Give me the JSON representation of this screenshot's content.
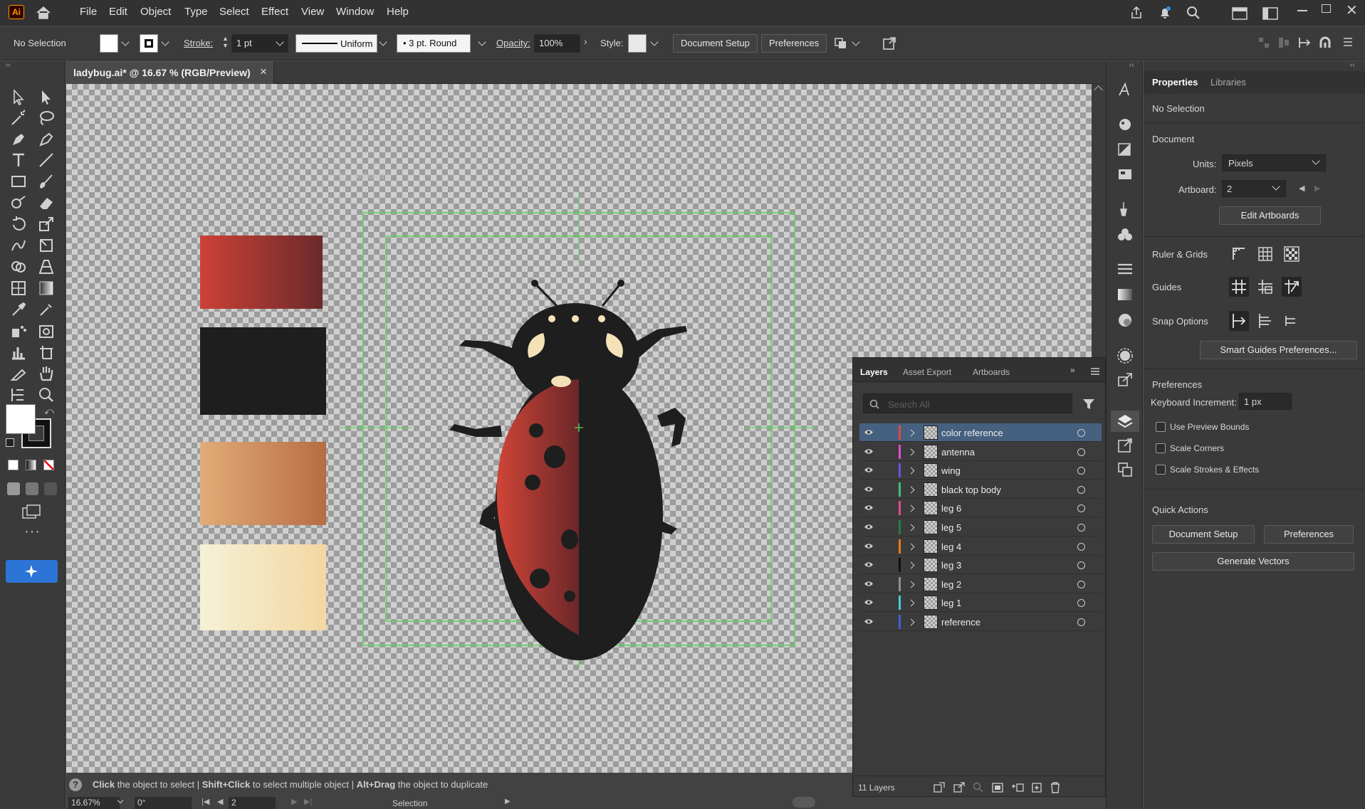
{
  "app": {
    "logo": "Ai"
  },
  "menu": [
    "File",
    "Edit",
    "Object",
    "Type",
    "Select",
    "Effect",
    "View",
    "Window",
    "Help"
  ],
  "control": {
    "selection": "No Selection",
    "stroke_label": "Stroke:",
    "stroke_weight": "1 pt",
    "stroke_profile": "Uniform",
    "brush": "3 pt. Round",
    "opacity_label": "Opacity:",
    "opacity": "100%",
    "style_label": "Style:",
    "document_setup": "Document Setup",
    "preferences": "Preferences"
  },
  "document_tab": {
    "title": "ladybug.ai* @ 16.67 % (RGB/Preview)",
    "close": "×"
  },
  "canvas": {
    "artboard_label": "01 - Artboard 1",
    "swatches": [
      "#c83f34",
      "#1e1e1e",
      "#d6905c",
      "#f4e8cc"
    ]
  },
  "status": {
    "hint_1": "Click",
    "hint_1b": " the object to select  |  ",
    "hint_2": "Shift+Click",
    "hint_2b": " to select multiple object  |  ",
    "hint_3": "Alt+Drag",
    "hint_3b": " the object to duplicate",
    "zoom": "16.67%",
    "rotation": "0°",
    "artboard_num": "2",
    "tool_name": "Selection"
  },
  "layers_panel": {
    "tabs": [
      "Layers",
      "Asset Export",
      "Artboards"
    ],
    "search_placeholder": "Search All",
    "count": "11 Layers",
    "layers": [
      {
        "name": "color reference",
        "color": "#e04848",
        "selected": true
      },
      {
        "name": "antenna",
        "color": "#e050d0",
        "selected": false
      },
      {
        "name": "wing",
        "color": "#7050e0",
        "selected": false
      },
      {
        "name": "black top body",
        "color": "#40c070",
        "selected": false
      },
      {
        "name": "leg 6",
        "color": "#e84890",
        "selected": false
      },
      {
        "name": "leg 5",
        "color": "#208040",
        "selected": false
      },
      {
        "name": "leg 4",
        "color": "#e87820",
        "selected": false
      },
      {
        "name": "leg 3",
        "color": "#101010",
        "selected": false
      },
      {
        "name": "leg 2",
        "color": "#909090",
        "selected": false
      },
      {
        "name": "leg 1",
        "color": "#40d0e0",
        "selected": false
      },
      {
        "name": "reference",
        "color": "#4060d8",
        "selected": false
      }
    ]
  },
  "properties": {
    "tabs": [
      "Properties",
      "Libraries"
    ],
    "selection": "No Selection",
    "document": "Document",
    "units_label": "Units:",
    "units": "Pixels",
    "artboard_label": "Artboard:",
    "artboard": "2",
    "edit_artboards": "Edit Artboards",
    "rulers_grids": "Ruler & Grids",
    "guides": "Guides",
    "snap_options": "Snap Options",
    "smart_guides": "Smart Guides Preferences...",
    "preferences_header": "Preferences",
    "keyboard_increment_label": "Keyboard Increment:",
    "keyboard_increment": "1 px",
    "use_preview_bounds": "Use Preview Bounds",
    "scale_corners": "Scale Corners",
    "scale_strokes": "Scale Strokes & Effects",
    "quick_actions": "Quick Actions",
    "document_setup": "Document Setup",
    "preferences": "Preferences",
    "generate_vectors": "Generate Vectors"
  }
}
